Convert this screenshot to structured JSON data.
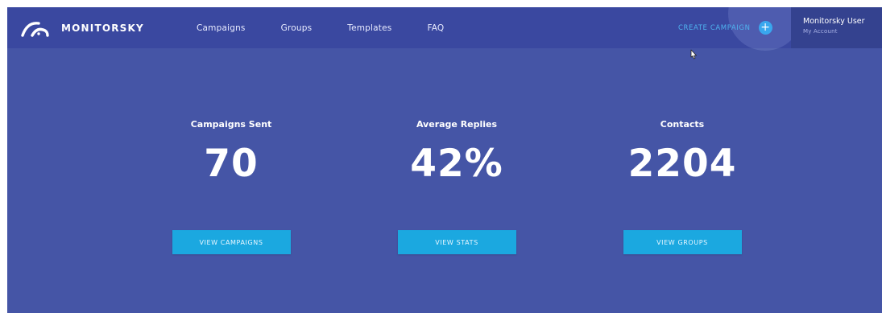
{
  "header": {
    "brand": "MONITORSKY",
    "nav": [
      "Campaigns",
      "Groups",
      "Templates",
      "FAQ"
    ],
    "create_label": "CREATE CAMPAIGN",
    "create_icon": "plus-icon",
    "user_name": "Monitorsky User",
    "user_sub": "My Account"
  },
  "stats": [
    {
      "label": "Campaigns Sent",
      "value": "70",
      "button": "VIEW CAMPAIGNS"
    },
    {
      "label": "Average Replies",
      "value": "42%",
      "button": "VIEW STATS"
    },
    {
      "label": "Contacts",
      "value": "2204",
      "button": "VIEW GROUPS"
    }
  ],
  "colors": {
    "background": "#4555a6",
    "header": "#3a48a0",
    "account_panel": "#34428f",
    "accent": "#1ba8e0",
    "create_link": "#4fb3ef"
  }
}
